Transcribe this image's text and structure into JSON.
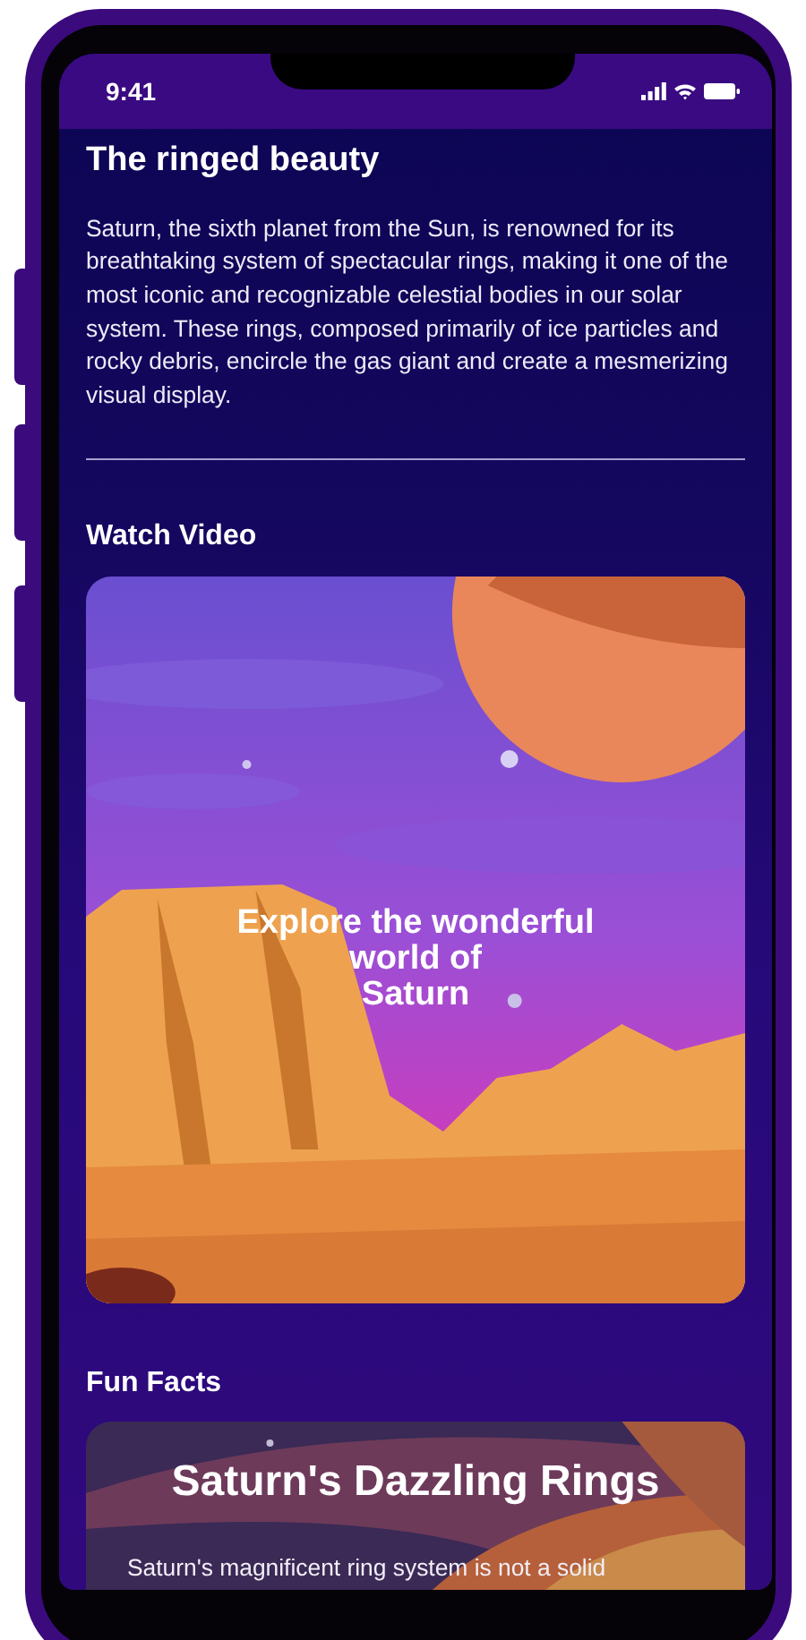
{
  "status_bar": {
    "time": "9:41"
  },
  "article": {
    "title": "The ringed beauty",
    "body": "Saturn, the sixth planet from the Sun, is renowned for its breathtaking system of spectacular rings, making it one of the most iconic and recognizable celestial bodies in our solar system. These rings, composed primarily of ice particles and rocky debris, encircle the gas giant and create a mesmerizing visual display."
  },
  "video": {
    "heading": "Watch Video",
    "caption": "Explore the wonderful\nworld of\nSaturn"
  },
  "fun_facts": {
    "heading": "Fun Facts",
    "cards": [
      {
        "title": "Saturn's Dazzling Rings",
        "body": "Saturn's magnificent ring system is not a solid"
      }
    ]
  }
}
